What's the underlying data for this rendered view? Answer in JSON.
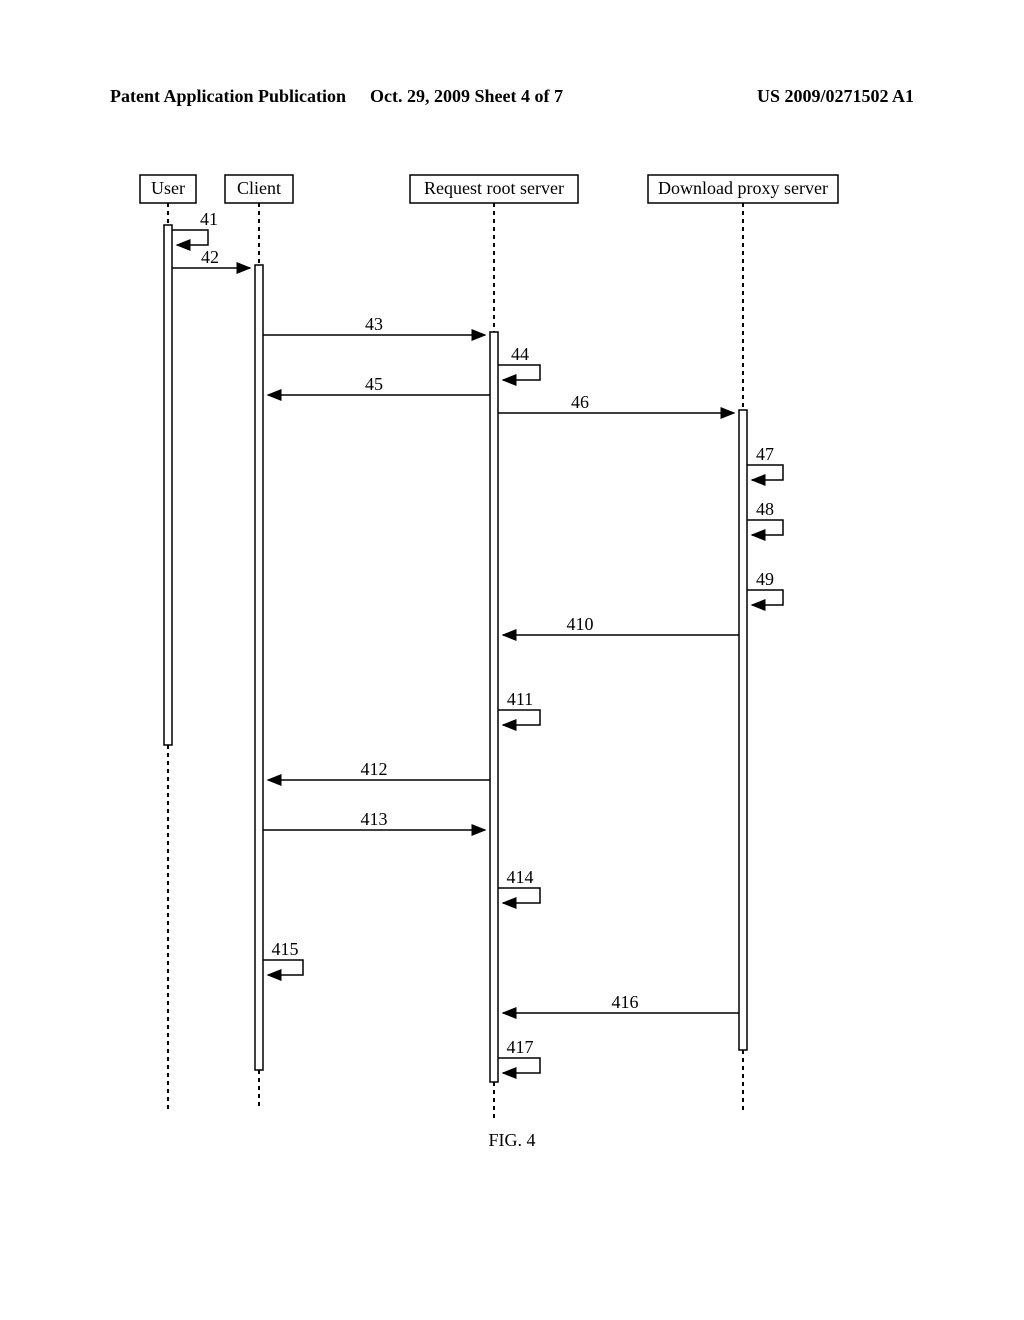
{
  "header": {
    "left": "Patent Application Publication",
    "center": "Oct. 29, 2009  Sheet 4 of 7",
    "right": "US 2009/0271502 A1"
  },
  "figure_label": "FIG. 4",
  "actors": {
    "user": "User",
    "client": "Client",
    "root": "Request root server",
    "proxy": "Download proxy server"
  },
  "messages": {
    "m41": "41",
    "m42": "42",
    "m43": "43",
    "m44": "44",
    "m45": "45",
    "m46": "46",
    "m47": "47",
    "m48": "48",
    "m49": "49",
    "m410": "410",
    "m411": "411",
    "m412": "412",
    "m413": "413",
    "m414": "414",
    "m415": "415",
    "m416": "416",
    "m417": "417"
  }
}
